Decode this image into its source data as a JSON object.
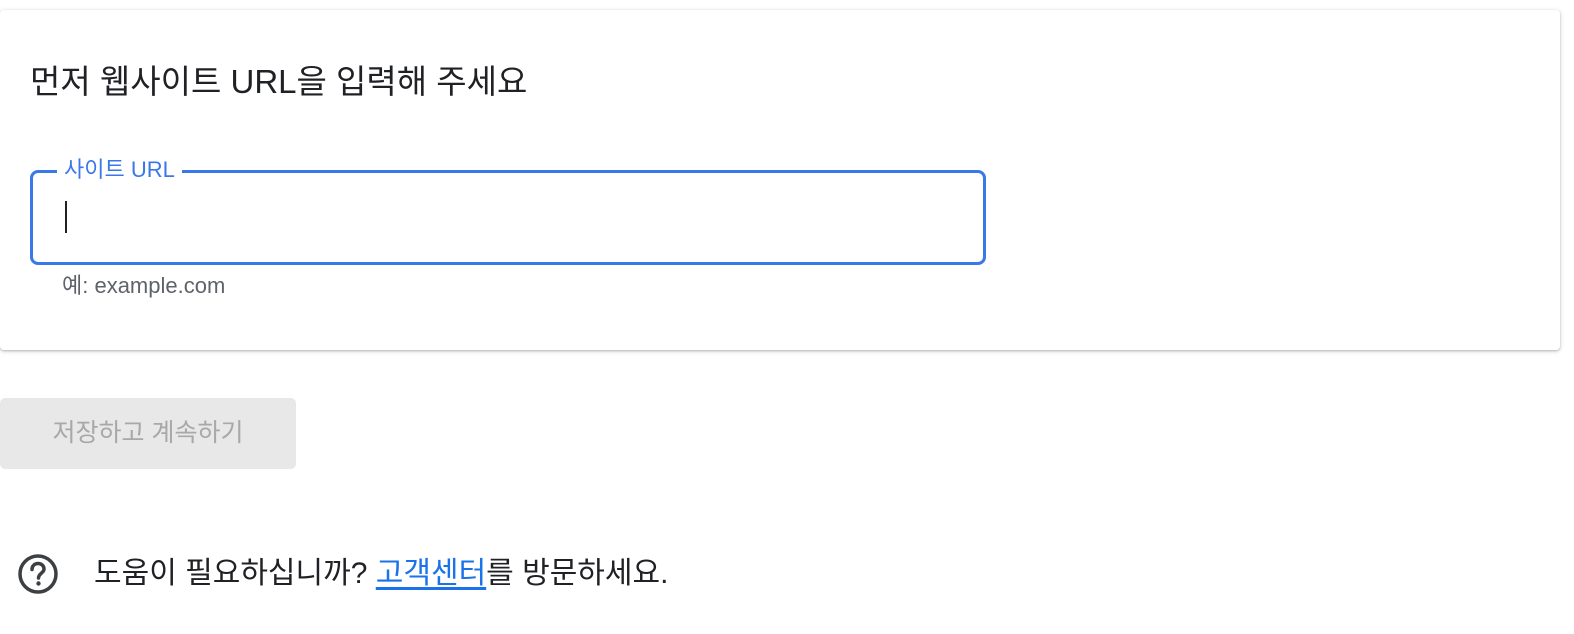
{
  "setup_card": {
    "title": "먼저 웹사이트 URL을 입력해 주세요",
    "site_url_field": {
      "label": "사이트 URL",
      "value": "",
      "hint": "예: example.com"
    }
  },
  "actions": {
    "save_continue_label": "저장하고 계속하기"
  },
  "help": {
    "icon": "help-circle-icon",
    "prefix": "도움이 필요하십니까? ",
    "link_text": "고객센터",
    "suffix": "를 방문하세요."
  },
  "colors": {
    "accent": "#3b78e7",
    "link": "#1a73e8",
    "disabled_bg": "#e8e8e8",
    "disabled_text": "#a8a8a8"
  }
}
